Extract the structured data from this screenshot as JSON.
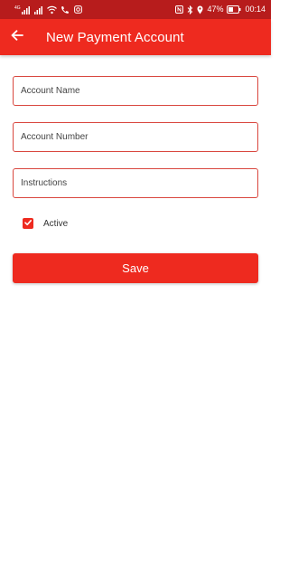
{
  "status_bar": {
    "network_label": "4G",
    "battery_percent": "47%",
    "time": "00:14"
  },
  "app_bar": {
    "title": "New Payment Account"
  },
  "form": {
    "fields": [
      {
        "placeholder": "Account Name",
        "value": ""
      },
      {
        "placeholder": "Account Number",
        "value": ""
      },
      {
        "placeholder": "Instructions",
        "value": ""
      }
    ],
    "active": {
      "label": "Active",
      "checked": true
    },
    "save_label": "Save"
  },
  "colors": {
    "status_bar": "#b71c1c",
    "app_bar": "#ee2a1f",
    "field_border": "#d9473f",
    "button": "#ee2a1f"
  }
}
